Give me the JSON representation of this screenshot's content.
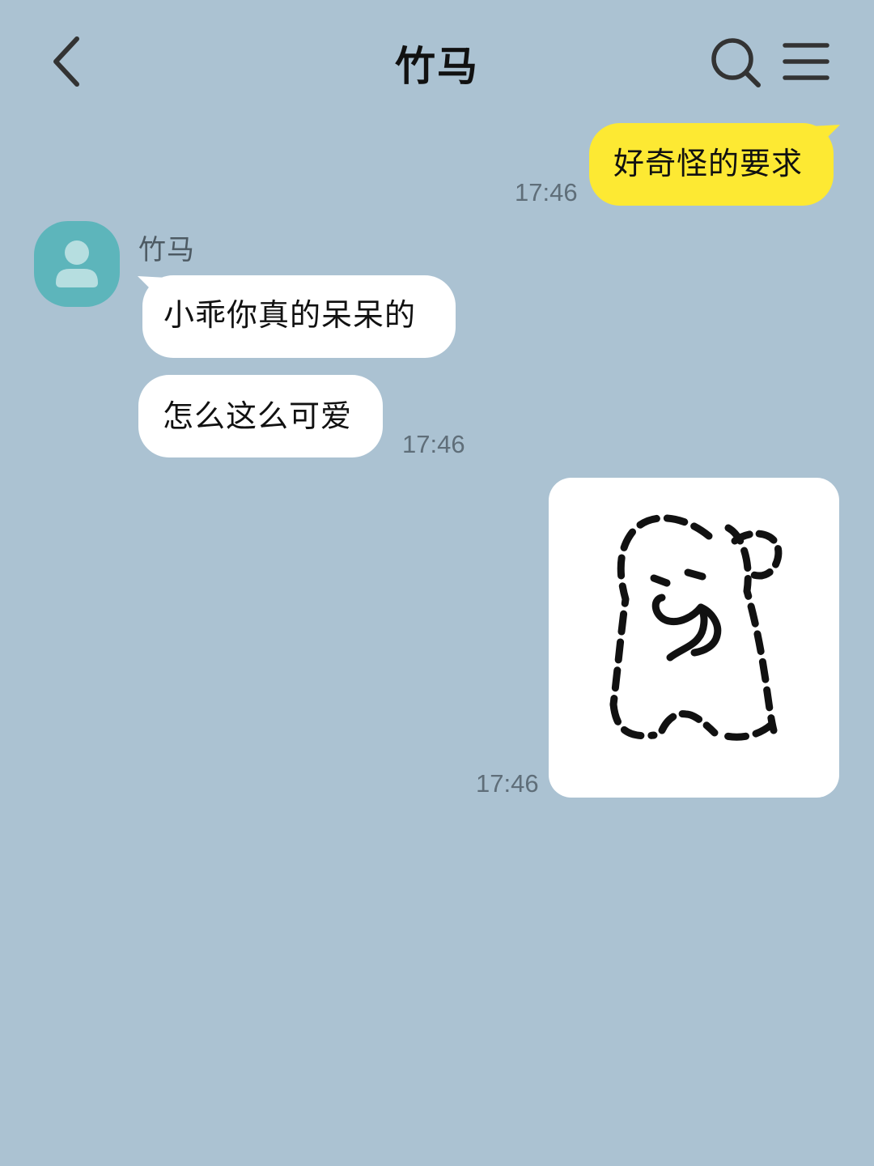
{
  "header": {
    "title": "竹马",
    "back_icon": "chevron-left-icon",
    "search_icon": "search-icon",
    "menu_icon": "hamburger-menu-icon"
  },
  "messages": [
    {
      "direction": "outgoing",
      "text": "好奇怪的要求",
      "time": "17:46"
    },
    {
      "direction": "incoming",
      "sender": "竹马",
      "text": "小乖你真的呆呆的"
    },
    {
      "direction": "incoming",
      "text": "怎么这么可爱",
      "time": "17:46"
    },
    {
      "direction": "outgoing",
      "type": "sticker",
      "sticker": "doodle-bear-sticker",
      "time": "17:46"
    }
  ],
  "colors": {
    "background": "#abc2d2",
    "outgoing_bubble": "#fde933",
    "incoming_bubble": "#ffffff",
    "avatar": "#5db5bb"
  }
}
